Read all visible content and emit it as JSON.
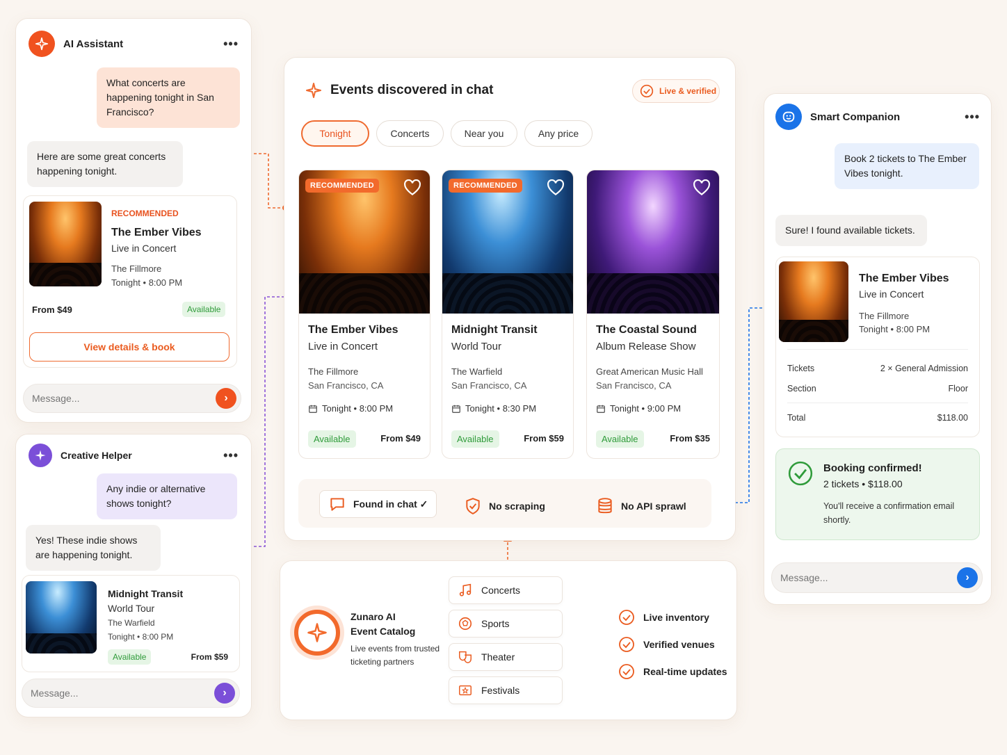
{
  "ai_assistant": {
    "title": "AI Assistant",
    "user_msg": "What concerts are happening tonight in San Francisco?",
    "bot_msg": "Here are some great concerts happening tonight.",
    "card": {
      "label": "RECOMMENDED",
      "title": "The Ember Vibes",
      "subtitle": "Live in Concert",
      "venue": "The Fillmore",
      "time": "Tonight • 8:00 PM",
      "price": "From $49",
      "status": "Available",
      "cta": "View details & book"
    },
    "input_placeholder": "Message..."
  },
  "creative_helper": {
    "title": "Creative Helper",
    "user_msg": "Any indie or alternative shows tonight?",
    "bot_msg": "Yes! These indie shows are happening tonight.",
    "card": {
      "title": "Midnight Transit",
      "subtitle": "World Tour",
      "venue": "The Warfield",
      "time": "Tonight • 8:00 PM",
      "status": "Available",
      "price": "From $59"
    },
    "input_placeholder": "Message..."
  },
  "events_panel": {
    "title": "Events discovered in chat",
    "badge": "Live & verified",
    "tabs": [
      "Tonight",
      "Concerts",
      "Near you",
      "Any price"
    ],
    "events": [
      {
        "label": "RECOMMENDED",
        "title": "The Ember Vibes",
        "subtitle": "Live in Concert",
        "venue": "The Fillmore",
        "city": "San Francisco, CA",
        "time": "Tonight • 8:00 PM",
        "status": "Available",
        "price": "From $49"
      },
      {
        "label": "RECOMMENDED",
        "title": "Midnight Transit",
        "subtitle": "World Tour",
        "venue": "The Warfield",
        "city": "San Francisco, CA",
        "time": "Tonight • 8:30 PM",
        "status": "Available",
        "price": "From $59"
      },
      {
        "label": "",
        "title": "The Coastal Sound",
        "subtitle": "Album Release Show",
        "venue": "Great American Music Hall",
        "city": "San Francisco, CA",
        "time": "Tonight • 9:00 PM",
        "status": "Available",
        "price": "From $35"
      }
    ],
    "features": [
      "Found in chat ✓",
      "No scraping",
      "No API sprawl"
    ]
  },
  "catalog": {
    "name_line1": "Zunaro AI",
    "name_line2": "Event Catalog",
    "desc": "Live events from trusted ticketing partners",
    "categories": [
      "Concerts",
      "Sports",
      "Theater",
      "Festivals"
    ],
    "checks": [
      "Live inventory",
      "Verified venues",
      "Real-time updates"
    ]
  },
  "smart_companion": {
    "title": "Smart Companion",
    "user_msg": "Book 2 tickets to The Ember Vibes tonight.",
    "bot_msg": "Sure! I found available tickets.",
    "card": {
      "title": "The Ember Vibes",
      "subtitle": "Live in Concert",
      "venue": "The Fillmore",
      "time": "Tonight • 8:00 PM"
    },
    "rows": [
      {
        "label": "Tickets",
        "value": "2 × General Admission"
      },
      {
        "label": "Section",
        "value": "Floor"
      },
      {
        "label": "Total",
        "value": "$118.00"
      }
    ],
    "confirm": {
      "title": "Booking confirmed!",
      "summary": "2 tickets • $118.00",
      "note": "You'll receive a confirmation email shortly."
    },
    "input_placeholder": "Message..."
  },
  "colors": {
    "accent": "#ef6a2f",
    "purple": "#7b4fd8",
    "blue": "#1a73e8",
    "green": "#2f9b3a"
  }
}
